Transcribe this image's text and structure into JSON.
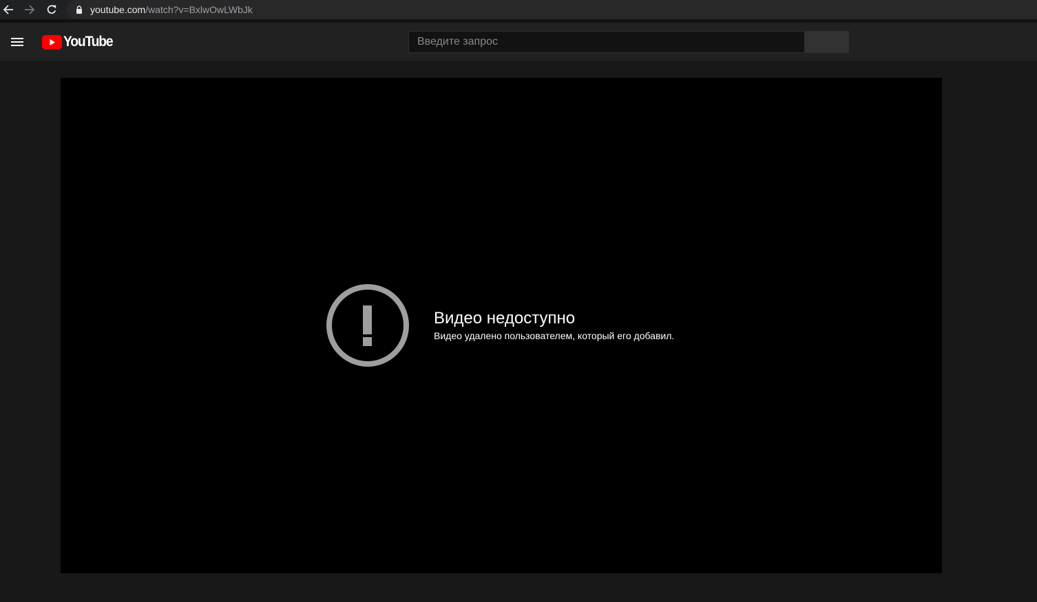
{
  "browser": {
    "url_host": "youtube.com",
    "url_path": "/watch?v=BxlwOwLWbJk"
  },
  "masthead": {
    "logo_text": "YouTube",
    "search_placeholder": "Введите запрос"
  },
  "player": {
    "error_title": "Видео недоступно",
    "error_subtitle": "Видео удалено пользователем, который его добавил."
  },
  "colors": {
    "page_background": "#181818",
    "masthead_background": "#212121",
    "player_background": "#000000",
    "logo_red": "#ff0000",
    "error_icon": "#9e9e9e"
  }
}
